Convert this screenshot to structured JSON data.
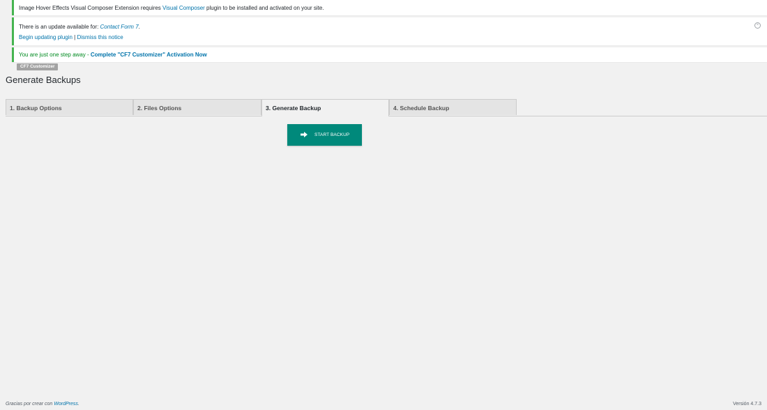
{
  "notices": {
    "vc": {
      "text_before": "Image Hover Effects Visual Composer Extension requires ",
      "link": "Visual Composer",
      "text_after": " plugin to be installed and activated on your site."
    },
    "update": {
      "text_before": "There is an update available for: ",
      "plugin_link": "Contact Form 7",
      "text_after": ".",
      "begin_link": "Begin updating plugin",
      "separator": " | ",
      "dismiss_link": "Dismiss this notice",
      "close_icon": "close-circle-icon"
    },
    "cf7": {
      "text_before": "You are just one step away - ",
      "link": "Complete \"CF7 Customizer\" Activation Now"
    }
  },
  "badge": "CF7 Customizer",
  "page_title": "Generate Backups",
  "tabs": [
    {
      "label": "1. Backup Options",
      "active": false
    },
    {
      "label": "2. Files Options",
      "active": false
    },
    {
      "label": "3. Generate Backup",
      "active": true
    },
    {
      "label": "4. Schedule Backup",
      "active": false
    }
  ],
  "start_button": {
    "label": "START BACKUP",
    "icon": "arrow-right-icon",
    "color": "#00897b"
  },
  "footer": {
    "thanks_before": "Gracias por crear con ",
    "thanks_link": "WordPress",
    "thanks_after": ".",
    "version": "Versión 4.7.3"
  },
  "colors": {
    "notice_success": "#46b450",
    "link": "#0073aa",
    "background": "#f1f1f1"
  }
}
